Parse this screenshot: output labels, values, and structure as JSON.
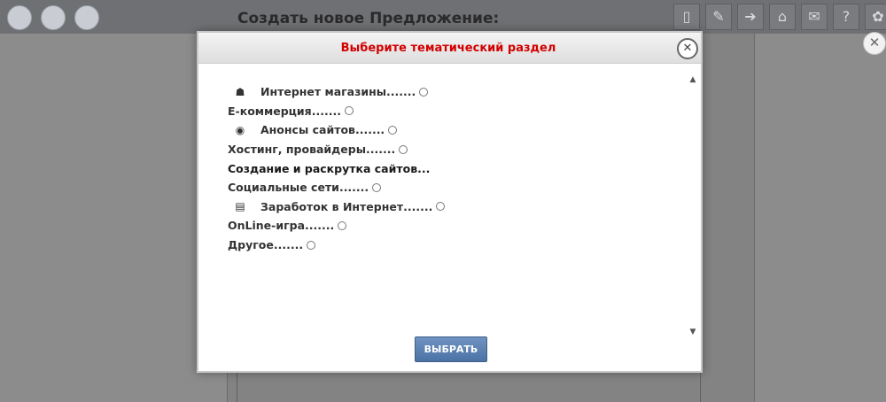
{
  "page": {
    "title": "Создать новое Предложение:"
  },
  "topbar": {
    "logos": [
      "logo-icon-1",
      "logo-icon-2",
      "logo-icon-3"
    ],
    "icons": [
      {
        "name": "phone-icon",
        "glyph": "▯"
      },
      {
        "name": "chat-icon",
        "glyph": "✎"
      },
      {
        "name": "login-icon",
        "glyph": "➔"
      },
      {
        "name": "home-icon",
        "glyph": "⌂"
      },
      {
        "name": "mail-icon",
        "glyph": "✉"
      },
      {
        "name": "help-icon",
        "glyph": "?"
      },
      {
        "name": "settings-icon",
        "glyph": "✿"
      }
    ]
  },
  "modal": {
    "title": "Выберите тематический раздел",
    "close_glyph": "✕",
    "items": [
      {
        "label": "Интернет магазины.......",
        "icon": "☗",
        "icon_name": "shop-icon",
        "radio": true,
        "indent": true
      },
      {
        "label": "Е-коммерция.......",
        "icon": "",
        "icon_name": "",
        "radio": true,
        "indent": false
      },
      {
        "label": "Анонсы сайтов.......",
        "icon": "◉",
        "icon_name": "globe-icon",
        "radio": true,
        "indent": true
      },
      {
        "label": "Хостинг, провайдеры.......",
        "icon": "",
        "icon_name": "",
        "radio": true,
        "indent": false
      },
      {
        "label": "Создание и раскрутка сайтов...",
        "icon": "",
        "icon_name": "",
        "radio": false,
        "indent": false
      },
      {
        "label": "Социальные сети.......",
        "icon": "",
        "icon_name": "",
        "radio": true,
        "indent": false
      },
      {
        "label": "Заработок в Интернет.......",
        "icon": "▤",
        "icon_name": "computer-icon",
        "radio": true,
        "indent": true
      },
      {
        "label": "OnLine-игра.......",
        "icon": "",
        "icon_name": "",
        "radio": true,
        "indent": false
      },
      {
        "label": "Другое.......",
        "icon": "",
        "icon_name": "",
        "radio": true,
        "indent": false
      }
    ],
    "button_label": "ВЫБРАТЬ"
  },
  "outer_close_glyph": "✕"
}
